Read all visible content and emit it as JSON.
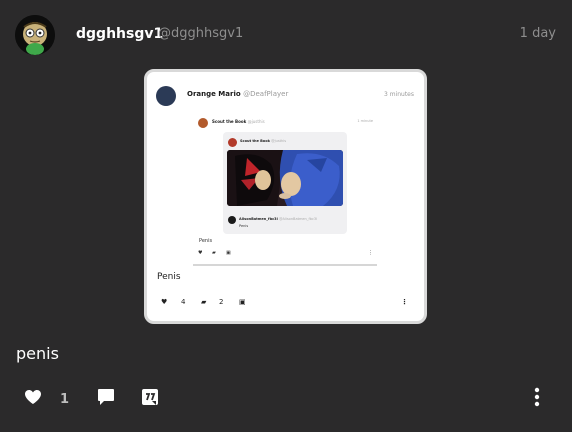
{
  "post": {
    "username": "dgghhsgv1",
    "handle": "@dgghhsgv1",
    "timestamp": "1 day",
    "text": "penis",
    "likes": "1"
  },
  "embed": {
    "name": "Orange Mario",
    "handle": "@DeafPlayer",
    "timestamp": "3 minutes",
    "text": "Penis",
    "likes": "4",
    "comments": "2",
    "quote1": {
      "name": "Scout the Book",
      "handle": "@justhis",
      "timestamp": "1 minute",
      "text": "Penis",
      "quote2": {
        "name": "Scout the Book",
        "handle": "@justhis",
        "reply_name": "AlisonBatmen_fbc3l",
        "reply_handle": "@AlisonBatmen_fbc3l",
        "reply_text": "Penis"
      }
    }
  },
  "icons": {
    "like": "heart-icon",
    "comment": "comment-bubble-icon",
    "quote": "quote-post-icon",
    "more": "more-vertical-icon"
  },
  "colors": {
    "background": "#2b2a2b",
    "text": "#ffffff",
    "muted": "#8e8e8e"
  }
}
